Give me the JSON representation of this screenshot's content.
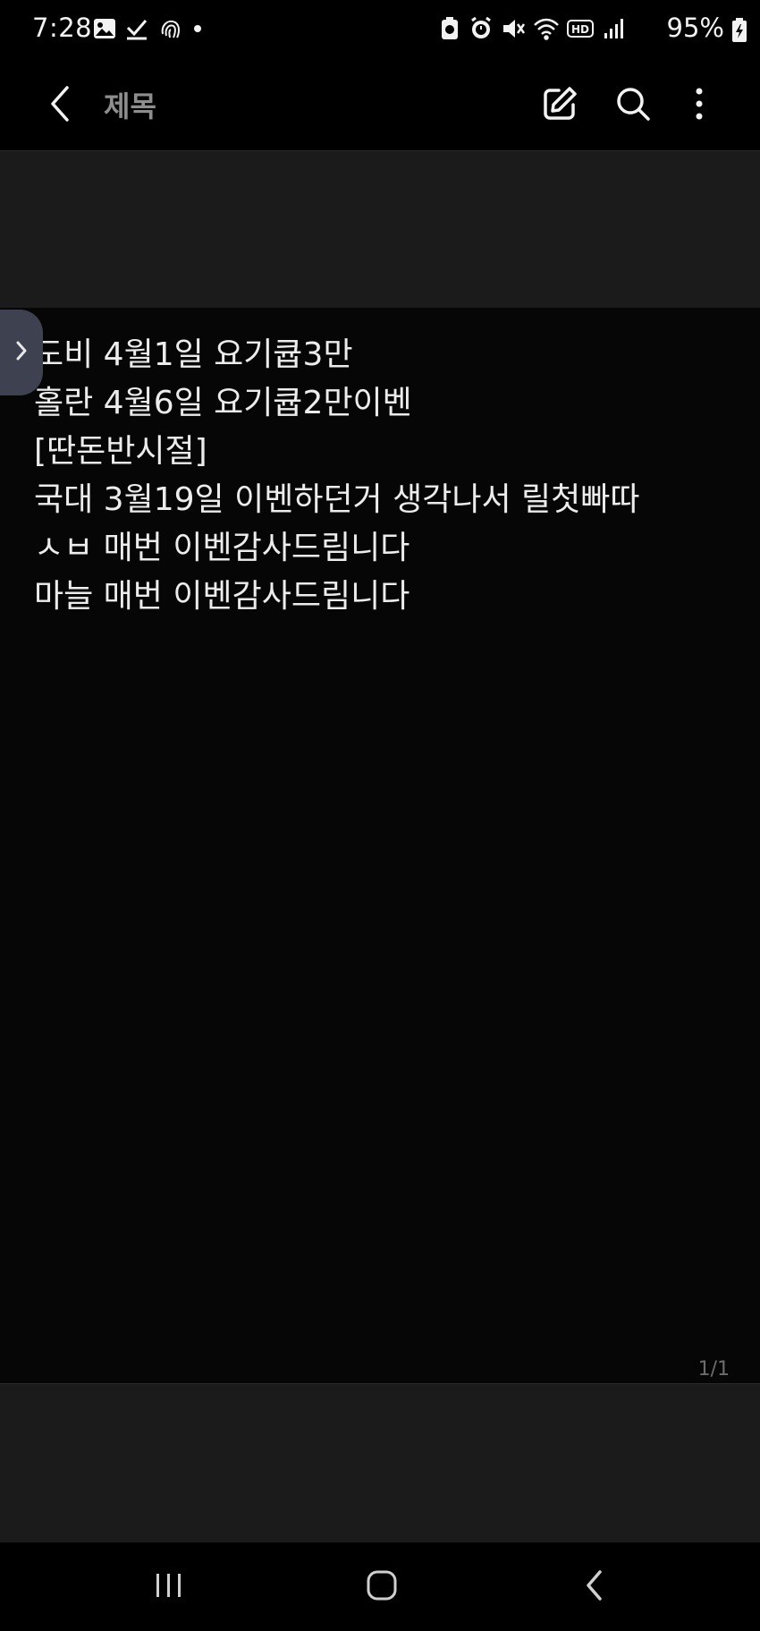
{
  "status_bar": {
    "time": "7:28",
    "battery_percent": "95%",
    "left_icons": [
      "gallery-icon",
      "checkmark-icon",
      "fingerprint-icon",
      "dot-icon"
    ],
    "right_icons": [
      "alarm-icon",
      "mute-icon",
      "wifi-icon",
      "hd-icon",
      "signal-icon",
      "battery-icon"
    ]
  },
  "app_bar": {
    "title": "제목",
    "actions": [
      "edit-icon",
      "search-icon",
      "more-vertical-icon"
    ]
  },
  "note": {
    "lines": [
      "도비 4월1일 요기큡3만",
      "홀란 4월6일 요기큡2만이벤",
      "[딴돈반시절]",
      "국대 3월19일 이벤하던거 생각나서 릴첫빠따",
      "ㅅㅂ 매번 이벤감사드림니다",
      "마늘 매번 이벤감사드림니다"
    ]
  },
  "page_indicator": "1/1",
  "nav_bar": {
    "buttons": [
      "recents-icon",
      "home-icon",
      "back-icon"
    ]
  },
  "colors": {
    "background": "#000000",
    "header_panel": "#1b1b1b",
    "note_body": "#060606",
    "text": "#ececec",
    "title_muted": "#8e8e8e",
    "side_tab": "#3e4250"
  }
}
